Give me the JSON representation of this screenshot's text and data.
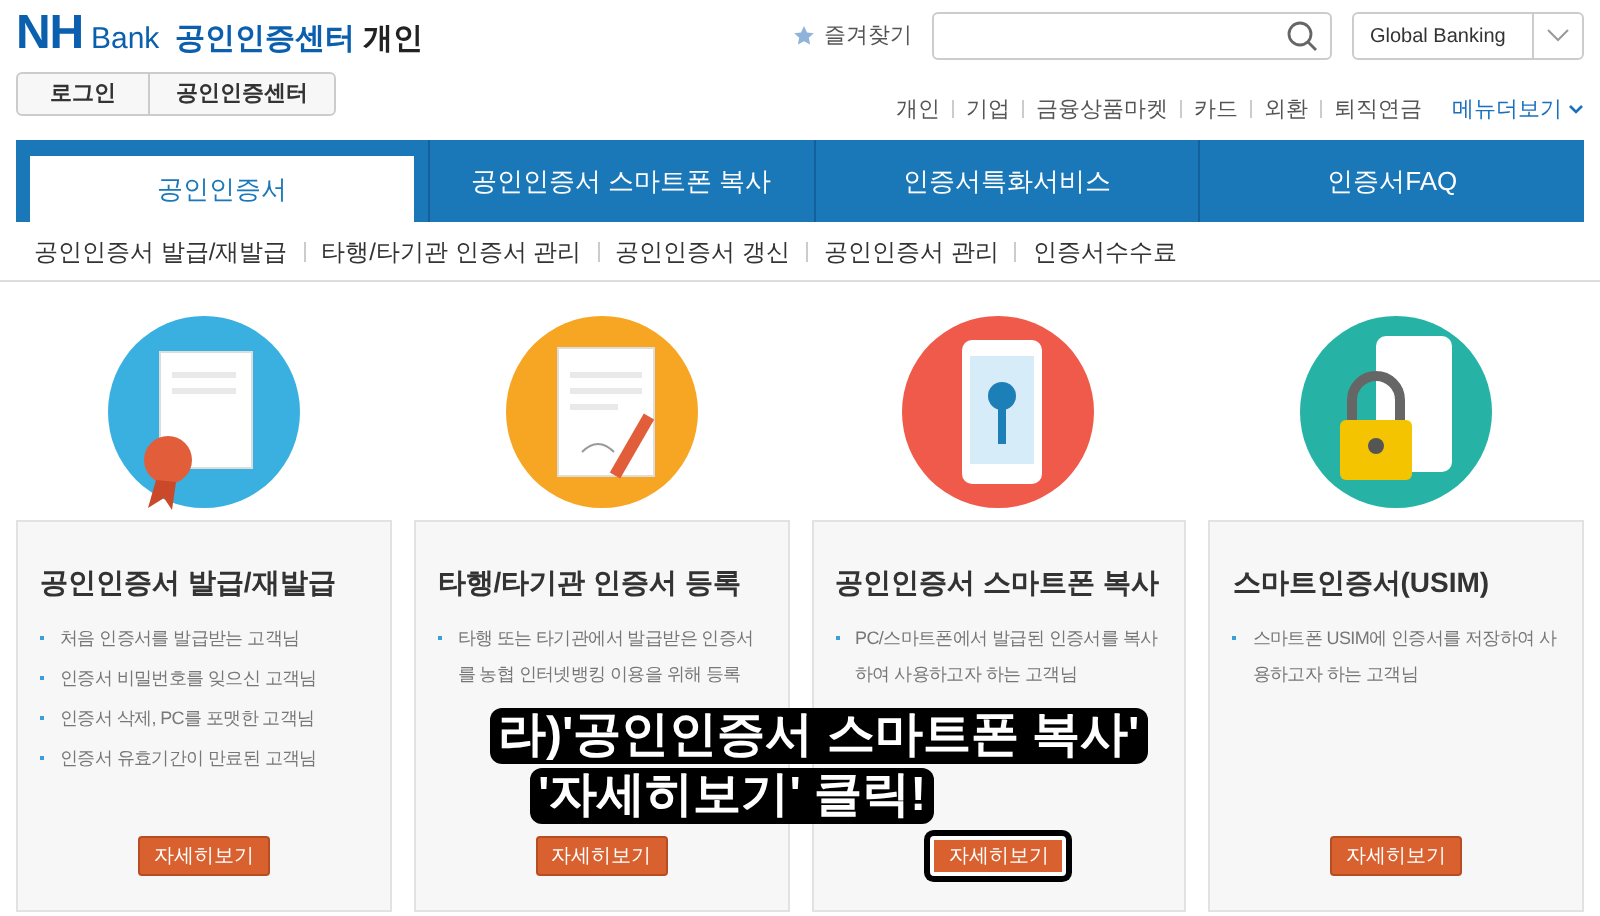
{
  "header": {
    "logo": "NH",
    "logo_sub": "Bank",
    "site_title": "공인인증센터",
    "site_section": "개인",
    "favorites": "즐겨찾기",
    "global": "Global Banking"
  },
  "top_buttons": [
    "로그인",
    "공인인증센터"
  ],
  "top_links": [
    "개인",
    "기업",
    "금융상품마켓",
    "카드",
    "외환",
    "퇴직연금"
  ],
  "more_menu": "메뉴더보기",
  "tabs": [
    {
      "label": "공인인증서",
      "selected": true
    },
    {
      "label": "공인인증서 스마트폰 복사",
      "selected": false
    },
    {
      "label": "인증서특화서비스",
      "selected": false
    },
    {
      "label": "인증서FAQ",
      "selected": false
    }
  ],
  "sub_menu": [
    "공인인증서 발급/재발급",
    "타행/타기관 인증서 관리",
    "공인인증서 갱신",
    "공인인증서 관리",
    "인증서수수료"
  ],
  "cards": [
    {
      "kind": "certificate",
      "title": "공인인증서 발급/재발급",
      "items": [
        "처음 인증서를 발급받는 고객님",
        "인증서 비밀번호를 잊으신 고객님",
        "인증서 삭제, PC를 포맷한 고객님",
        "인증서 유효기간이 만료된 고객님"
      ],
      "button": "자세히보기",
      "highlighted": false
    },
    {
      "kind": "document",
      "title": "타행/타기관 인증서 등록",
      "items": [
        "타행 또는 타기관에서 발급받은 인증서를 농협 인터넷뱅킹 이용을 위해 등록"
      ],
      "button": "자세히보기",
      "highlighted": false
    },
    {
      "kind": "phone",
      "title": "공인인증서 스마트폰 복사",
      "items": [
        "PC/스마트폰에서 발급된 인증서를 복사하여 사용하고자 하는 고객님"
      ],
      "button": "자세히보기",
      "highlighted": true
    },
    {
      "kind": "lock",
      "title": "스마트인증서(USIM)",
      "items": [
        "스마트폰 USIM에 인증서를 저장하여 사용하고자 하는 고객님"
      ],
      "button": "자세히보기",
      "highlighted": false
    }
  ],
  "annotation": [
    "라)'공인인증서 스마트폰 복사'",
    "'자세히보기' 클릭!"
  ]
}
